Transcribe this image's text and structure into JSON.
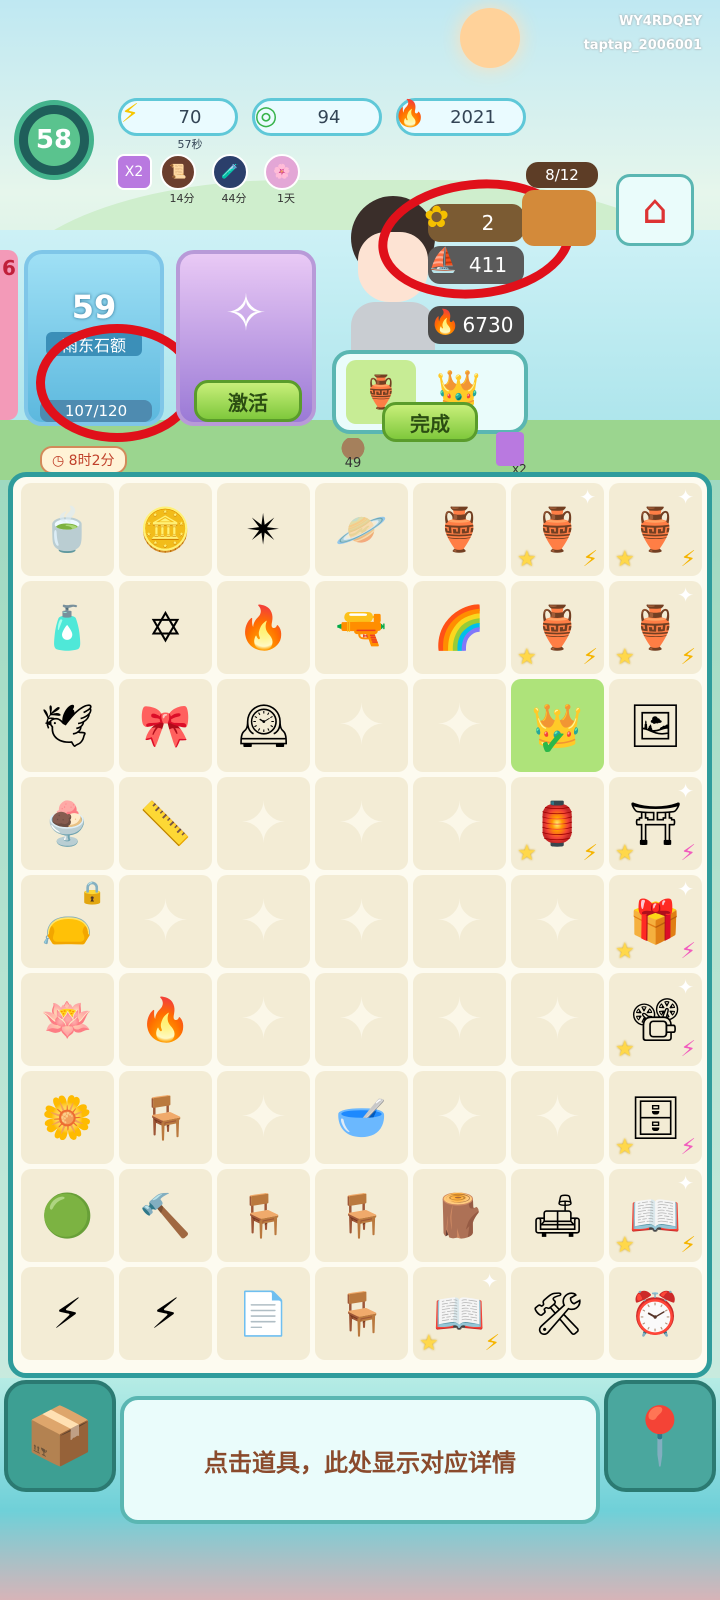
{
  "watermark": {
    "line1": "WY4RDQEY",
    "line2": "taptap_2006001"
  },
  "player": {
    "level": "58"
  },
  "resources": [
    {
      "icon": "energy-bolt",
      "value": "70",
      "sub": "57秒"
    },
    {
      "icon": "jade-coin",
      "value": "94"
    },
    {
      "icon": "blue-flame",
      "value": "2021"
    }
  ],
  "boosts": [
    {
      "label": "X2"
    },
    {
      "label": "14分"
    },
    {
      "label": "44分"
    },
    {
      "label": "1天"
    }
  ],
  "side_counter": "6",
  "card_left": {
    "level": "59",
    "label": "雨东石额",
    "progress": "107/120"
  },
  "card_mid": {
    "button": "激活"
  },
  "timer_text": "8时2分",
  "character": {
    "sunflower_count": "2",
    "paper_boat_count": "411",
    "flame_count": "6730"
  },
  "shop": {
    "progress": "8/12"
  },
  "order": {
    "button": "完成"
  },
  "below_order": {
    "count": "49",
    "multiplier": "x2"
  },
  "board": {
    "rows": [
      [
        "teacup-stack",
        "bagua-mirror",
        "pinwheel-shuriken",
        "crystal-planet",
        "blue-white-vase",
        "porcelain-jar-wine",
        "porcelain-jar-wine"
      ],
      [
        "potion-bottle",
        "star-knot",
        "blue-flames",
        "green-pistol",
        "rainbow-slinky",
        "porcelain-jar-wine",
        "porcelain-jar-wine"
      ],
      [
        "paper-crane",
        "ribbon-bow",
        "bagua-clock",
        "",
        "",
        "gold-crown",
        "photo-frame"
      ],
      [
        "ice-cream-keychain",
        "wooden-ruler",
        "",
        "",
        "",
        "incense-shelf",
        "shrine-cabinet"
      ],
      [
        "red-pouch",
        "",
        "",
        "",
        "",
        "",
        "gift-box"
      ],
      [
        "white-lotus",
        "blue-flame",
        "",
        "",
        "",
        "",
        "movie-projector"
      ],
      [
        "lily-flower",
        "wooden-stool",
        "",
        "white-pot",
        "",
        "",
        "wooden-cabinet"
      ],
      [
        "jade-coin",
        "stone-hammer",
        "wooden-chair",
        "wooden-chair",
        "wood-piece",
        "wooden-bench",
        "old-book"
      ],
      [
        "energy-bolts",
        "energy-bolt",
        "paper-sheets",
        "wooden-chair",
        "old-book",
        "sewing-lamp",
        "alarm-clock"
      ]
    ]
  },
  "info_panel": {
    "text": "点击道具，此处显示对应详情"
  },
  "colors": {
    "board_border": "#2f9c9c",
    "annotation_red": "#e0101a",
    "selected_cell": "#aee37a"
  }
}
